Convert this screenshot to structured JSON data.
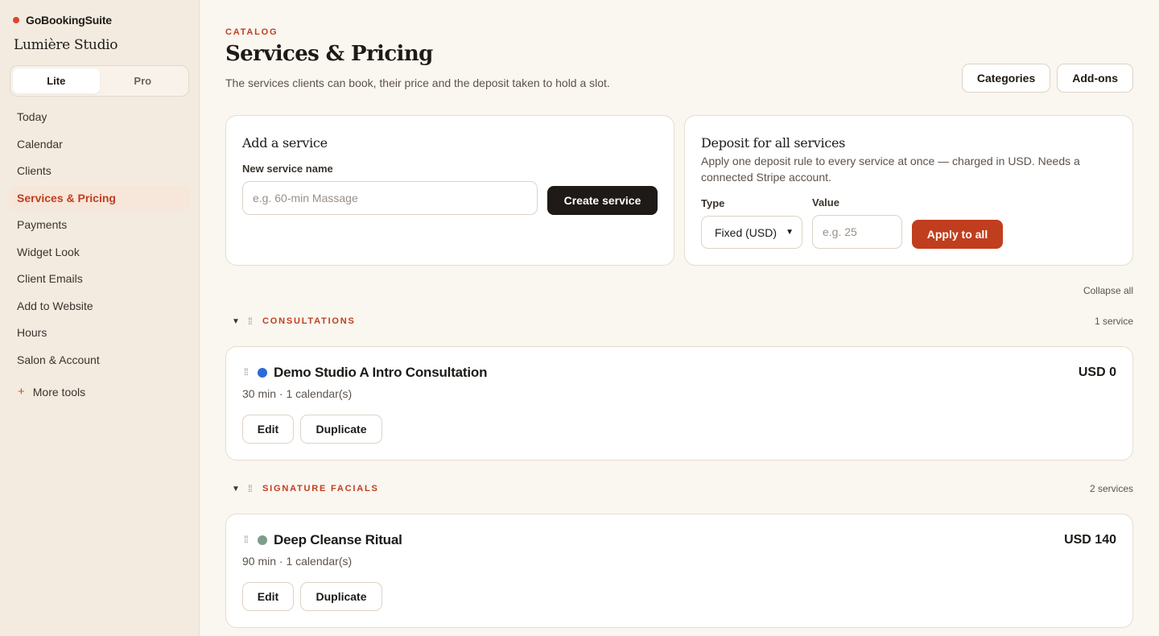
{
  "app": {
    "brand": "GoBookingSuite",
    "studio": "Lumière Studio",
    "brand_dot_color": "#e0432c"
  },
  "plan_toggle": {
    "options": [
      "Lite",
      "Pro"
    ],
    "selected": "Lite"
  },
  "sidebar": {
    "items": [
      {
        "label": "Today"
      },
      {
        "label": "Calendar"
      },
      {
        "label": "Clients"
      },
      {
        "label": "Services & Pricing",
        "active": true
      },
      {
        "label": "Payments"
      },
      {
        "label": "Widget Look"
      },
      {
        "label": "Client Emails"
      },
      {
        "label": "Add to Website"
      },
      {
        "label": "Hours"
      },
      {
        "label": "Salon & Account"
      }
    ],
    "more_tools": "More tools",
    "more_tools_icon": "plus-icon"
  },
  "header": {
    "eyebrow": "CATALOG",
    "title": "Services & Pricing",
    "subtitle": "The services clients can book, their price and the deposit taken to hold a slot.",
    "buttons": [
      "Categories",
      "Add-ons"
    ]
  },
  "add_service": {
    "title": "Add a service",
    "field_label": "New service name",
    "placeholder": "e.g. 60-min Massage",
    "value": "",
    "button": "Create service"
  },
  "deposit": {
    "title": "Deposit for all services",
    "description": "Apply one deposit rule to every service at once — charged in USD. Needs a connected Stripe account.",
    "type_label": "Type",
    "type_value": "Fixed (USD)",
    "value_label": "Value",
    "value_placeholder": "e.g. 25",
    "button": "Apply to all"
  },
  "collapse_all": "Collapse all",
  "groups": [
    {
      "name": "CONSULTATIONS",
      "count": "1 service",
      "services": [
        {
          "name": "Demo Studio A Intro Consultation",
          "meta": "30 min · 1 calendar(s)",
          "price": "USD 0",
          "color": "#2d6ad8",
          "edit": "Edit",
          "duplicate": "Duplicate"
        }
      ]
    },
    {
      "name": "SIGNATURE FACIALS",
      "count": "2 services",
      "services": [
        {
          "name": "Deep Cleanse Ritual",
          "meta": "90 min · 1 calendar(s)",
          "price": "USD 140",
          "color": "#7f9d8a",
          "edit": "Edit",
          "duplicate": "Duplicate"
        }
      ]
    }
  ],
  "colors": {
    "accent": "#c03e1e",
    "dark": "#1d1a17",
    "sidebar_bg": "#f3ebe0",
    "page_bg": "#faf6f0"
  }
}
